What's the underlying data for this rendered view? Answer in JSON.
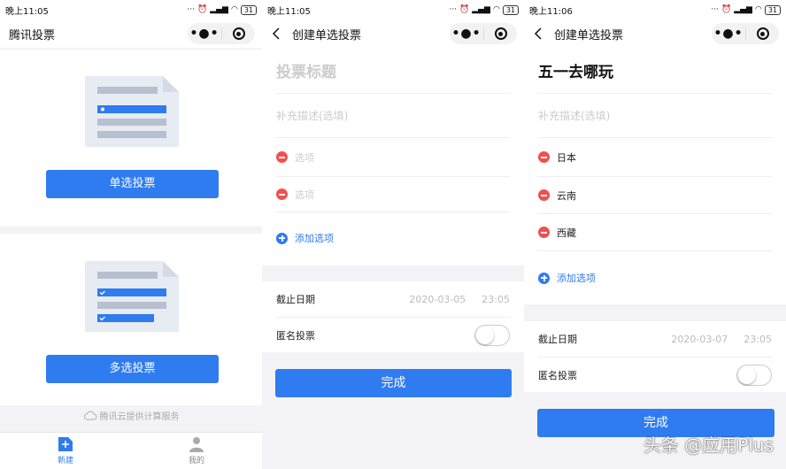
{
  "colors": {
    "accent": "#2f7bf0",
    "danger": "#f05050",
    "page_bg": "#f3f3f5"
  },
  "screen1": {
    "status": {
      "time": "晚上11:05",
      "battery": "31"
    },
    "nav": {
      "title": "腾讯投票",
      "more_icon": "•●•"
    },
    "single_button": "单选投票",
    "multi_button": "多选投票",
    "footer": "腾讯云提供计算服务",
    "tabs": [
      {
        "label": "新建",
        "icon": "plus-icon"
      },
      {
        "label": "我的",
        "icon": "user-icon"
      }
    ]
  },
  "screen2": {
    "status": {
      "time": "晚上11:05",
      "battery": "31"
    },
    "nav": {
      "title": "创建单选投票",
      "more_icon": "•●•"
    },
    "title_placeholder": "投票标题",
    "desc_placeholder": "补充描述(选填)",
    "options": [
      {
        "placeholder": "选项"
      },
      {
        "placeholder": "选项"
      }
    ],
    "add_option": "添加选项",
    "deadline_label": "截止日期",
    "deadline_date": "2020-03-05",
    "deadline_time": "23:05",
    "anonymous_label": "匿名投票",
    "done_button": "完成"
  },
  "screen3": {
    "status": {
      "time": "晚上11:06",
      "battery": "31"
    },
    "nav": {
      "title": "创建单选投票",
      "more_icon": "•●•"
    },
    "title_value": "五一去哪玩",
    "desc_placeholder": "补充描述(选填)",
    "options": [
      {
        "value": "日本"
      },
      {
        "value": "云南"
      },
      {
        "value": "西藏"
      }
    ],
    "add_option": "添加选项",
    "deadline_label": "截止日期",
    "deadline_date": "2020-03-07",
    "deadline_time": "23:05",
    "anonymous_label": "匿名投票",
    "done_button": "完成"
  },
  "watermark": "头条 @应用Plus"
}
